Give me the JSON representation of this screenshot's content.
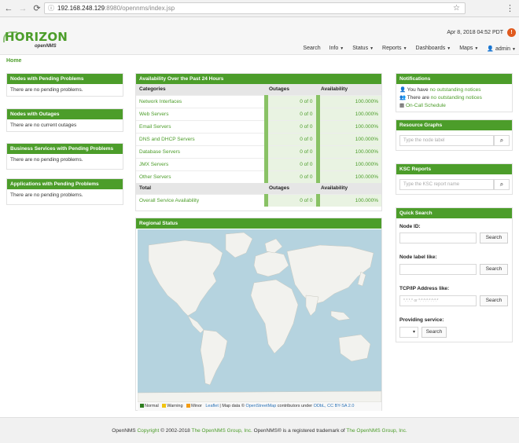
{
  "browser": {
    "url_host": "192.168.248.129",
    "url_path": ":8980/opennms/index.jsp"
  },
  "header": {
    "logo_main": "HORIZON",
    "logo_sub": "openNMS",
    "datetime": "Apr 8, 2018 04:52 PDT",
    "nav": [
      "Search",
      "Info",
      "Status",
      "Reports",
      "Dashboards",
      "Maps",
      "admin"
    ]
  },
  "breadcrumb": "Home",
  "left_panels": [
    {
      "title": "Nodes with Pending Problems",
      "body": "There are no pending problems."
    },
    {
      "title": "Nodes with Outages",
      "body": "There are no current outages"
    },
    {
      "title": "Business Services with Pending Problems",
      "body": "There are no pending problems."
    },
    {
      "title": "Applications with Pending Problems",
      "body": "There are no pending problems."
    }
  ],
  "availability": {
    "title": "Availability Over the Past 24 Hours",
    "headers": [
      "Categories",
      "Outages",
      "Availability"
    ],
    "rows": [
      {
        "category": "Network Interfaces",
        "outages": "0 of 0",
        "availability": "100.000%"
      },
      {
        "category": "Web Servers",
        "outages": "0 of 0",
        "availability": "100.000%"
      },
      {
        "category": "Email Servers",
        "outages": "0 of 0",
        "availability": "100.000%"
      },
      {
        "category": "DNS and DHCP Servers",
        "outages": "0 of 0",
        "availability": "100.000%"
      },
      {
        "category": "Database Servers",
        "outages": "0 of 0",
        "availability": "100.000%"
      },
      {
        "category": "JMX Servers",
        "outages": "0 of 0",
        "availability": "100.000%"
      },
      {
        "category": "Other Servers",
        "outages": "0 of 0",
        "availability": "100.000%"
      }
    ],
    "total_headers": [
      "Total",
      "Outages",
      "Availability"
    ],
    "total_row": {
      "category": "Overall Service Availability",
      "outages": "0 of 0",
      "availability": "100.000%"
    }
  },
  "regional": {
    "title": "Regional Status",
    "legend": [
      "Normal",
      "Warning",
      "Minor"
    ],
    "attribution_leaflet": "Leaflet",
    "attribution_text1": "| Map data ©",
    "attribution_osm": "OpenStreetMap",
    "attribution_text2": "contributors under",
    "attribution_license": "ODbL, CC BY-SA 2.0"
  },
  "notifications": {
    "title": "Notifications",
    "line1_prefix": "You have",
    "line1_link": "no outstanding notices",
    "line2_prefix": "There are",
    "line2_link": "no outstanding notices",
    "line3_link": "On-Call Schedule"
  },
  "resource_graphs": {
    "title": "Resource Graphs",
    "placeholder": "Type the node label"
  },
  "ksc_reports": {
    "title": "KSC Reports",
    "placeholder": "Type the KSC report name"
  },
  "quick_search": {
    "title": "Quick Search",
    "node_id_label": "Node ID:",
    "node_label_label": "Node label like:",
    "ip_label": "TCP/IP Address like:",
    "ip_placeholder": "*.*.*.* or *:*:*:*:*:*:*:*",
    "service_label": "Providing service:",
    "search_label": "Search"
  },
  "footer": {
    "p1": "OpenNMS",
    "copyright": "Copyright",
    "years": "© 2002-2018",
    "org": "The OpenNMS Group, Inc.",
    "trademark": "OpenNMS® is a registered trademark of",
    "org2": "The OpenNMS Group, Inc."
  },
  "colors": {
    "brand": "#4c9d2a",
    "map_water": "#b5d3df",
    "land": "#f2f2ee"
  }
}
